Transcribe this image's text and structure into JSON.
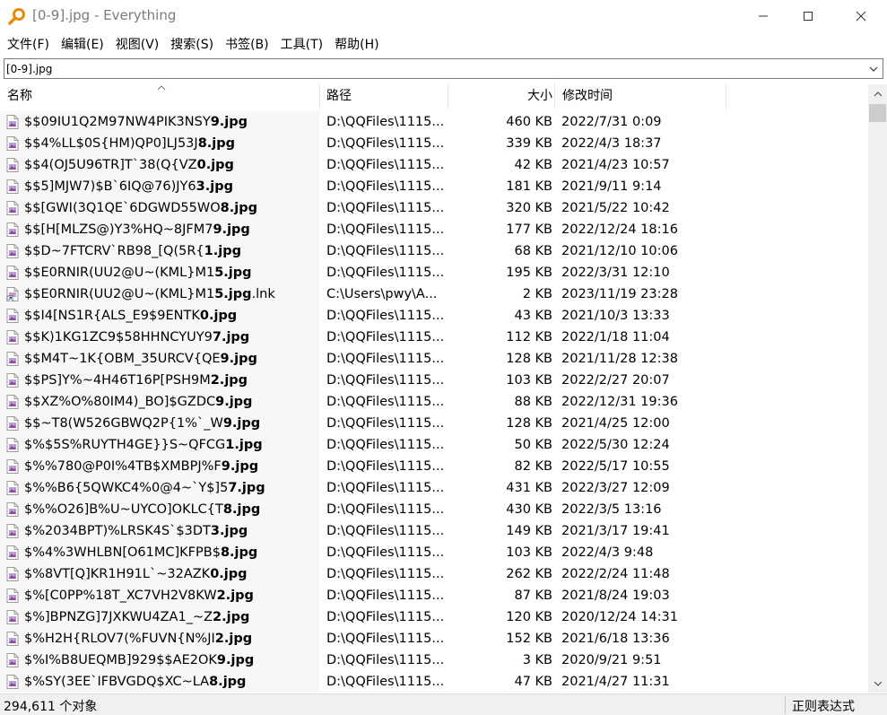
{
  "window": {
    "title": "[0-9].jpg - Everything",
    "app_icon": "magnifier-icon",
    "controls": [
      "minimize-icon",
      "maximize-icon",
      "close-icon"
    ]
  },
  "menu": [
    "文件(F)",
    "编辑(E)",
    "视图(V)",
    "搜索(S)",
    "书签(B)",
    "工具(T)",
    "帮助(H)"
  ],
  "search": {
    "value": "[0-9].jpg"
  },
  "columns": {
    "name": "名称",
    "path": "路径",
    "size": "大小",
    "date": "修改时间",
    "sorted_by": "name",
    "sort_dir": "ascending"
  },
  "rows": [
    {
      "pre": "$$09IU1Q2M97NW4PIK3NSY",
      "match": "9.jpg",
      "post": "",
      "path": "D:\\QQFiles\\1115...",
      "size": "460 KB",
      "date": "2022/7/31 0:09",
      "icon": "image-file-icon"
    },
    {
      "pre": "$$4%LL$0S{HM)QP0]LJ53J",
      "match": "8.jpg",
      "post": "",
      "path": "D:\\QQFiles\\1115...",
      "size": "339 KB",
      "date": "2022/4/3 18:37",
      "icon": "image-file-icon"
    },
    {
      "pre": "$$4(OJ5U96TR]T`38(Q{VZ",
      "match": "0.jpg",
      "post": "",
      "path": "D:\\QQFiles\\1115...",
      "size": "42 KB",
      "date": "2021/4/23 10:57",
      "icon": "image-file-icon"
    },
    {
      "pre": "$$5]MJW7)$B`6IQ@76)JY6",
      "match": "3.jpg",
      "post": "",
      "path": "D:\\QQFiles\\1115...",
      "size": "181 KB",
      "date": "2021/9/11 9:14",
      "icon": "image-file-icon"
    },
    {
      "pre": "$$[GWI(3Q1QE`6DGWD55WO",
      "match": "8.jpg",
      "post": "",
      "path": "D:\\QQFiles\\1115...",
      "size": "320 KB",
      "date": "2021/5/22 10:42",
      "icon": "image-file-icon"
    },
    {
      "pre": "$$[H[MLZS@)Y3%HQ~8JFM7",
      "match": "9.jpg",
      "post": "",
      "path": "D:\\QQFiles\\1115...",
      "size": "177 KB",
      "date": "2022/12/24 18:16",
      "icon": "image-file-icon"
    },
    {
      "pre": "$$D~7FTCRV`RB98_[Q(5R{",
      "match": "1.jpg",
      "post": "",
      "path": "D:\\QQFiles\\1115...",
      "size": "68 KB",
      "date": "2021/12/10 10:06",
      "icon": "image-file-icon"
    },
    {
      "pre": "$$E0RNIR(UU2@U~(KML}M1",
      "match": "5.jpg",
      "post": "",
      "path": "D:\\QQFiles\\1115...",
      "size": "195 KB",
      "date": "2022/3/31 12:10",
      "icon": "image-file-icon"
    },
    {
      "pre": "$$E0RNIR(UU2@U~(KML}M1",
      "match": "5.jpg",
      "post": ".lnk",
      "path": "C:\\Users\\pwy\\A...",
      "size": "2 KB",
      "date": "2023/11/19 23:28",
      "icon": "shortcut-file-icon"
    },
    {
      "pre": "$$I4[NS1R{ALS_E9$9ENTK",
      "match": "0.jpg",
      "post": "",
      "path": "D:\\QQFiles\\1115...",
      "size": "43 KB",
      "date": "2021/10/3 13:33",
      "icon": "image-file-icon"
    },
    {
      "pre": "$$K)1KG1ZC9$58HHNCYUY9",
      "match": "7.jpg",
      "post": "",
      "path": "D:\\QQFiles\\1115...",
      "size": "112 KB",
      "date": "2022/1/18 11:04",
      "icon": "image-file-icon"
    },
    {
      "pre": "$$M4T~1K{OBM_35URCV{QE",
      "match": "9.jpg",
      "post": "",
      "path": "D:\\QQFiles\\1115...",
      "size": "128 KB",
      "date": "2021/11/28 12:38",
      "icon": "image-file-icon"
    },
    {
      "pre": "$$PS]Y%~4H46T16P[PSH9M",
      "match": "2.jpg",
      "post": "",
      "path": "D:\\QQFiles\\1115...",
      "size": "103 KB",
      "date": "2022/2/27 20:07",
      "icon": "image-file-icon"
    },
    {
      "pre": "$$XZ%O%80IM4)_BO]$GZDC",
      "match": "9.jpg",
      "post": "",
      "path": "D:\\QQFiles\\1115...",
      "size": "88 KB",
      "date": "2022/12/31 19:36",
      "icon": "image-file-icon"
    },
    {
      "pre": "$$~T8(W526GBWQ2P{1%`_W",
      "match": "9.jpg",
      "post": "",
      "path": "D:\\QQFiles\\1115...",
      "size": "128 KB",
      "date": "2021/4/25 12:00",
      "icon": "image-file-icon"
    },
    {
      "pre": "$%$5S%RUYTH4GE}}S~QFCG",
      "match": "1.jpg",
      "post": "",
      "path": "D:\\QQFiles\\1115...",
      "size": "50 KB",
      "date": "2022/5/30 12:24",
      "icon": "image-file-icon"
    },
    {
      "pre": "$%%780@P0I%4TB$XMBPJ%F",
      "match": "9.jpg",
      "post": "",
      "path": "D:\\QQFiles\\1115...",
      "size": "82 KB",
      "date": "2022/5/17 10:55",
      "icon": "image-file-icon"
    },
    {
      "pre": "$%%B6{5QWKC4%0@4~`Y$]5",
      "match": "7.jpg",
      "post": "",
      "path": "D:\\QQFiles\\1115...",
      "size": "431 KB",
      "date": "2022/3/27 12:09",
      "icon": "image-file-icon"
    },
    {
      "pre": "$%%O26]B%U~UYCO]OKLC{T",
      "match": "8.jpg",
      "post": "",
      "path": "D:\\QQFiles\\1115...",
      "size": "430 KB",
      "date": "2022/3/5 13:16",
      "icon": "image-file-icon"
    },
    {
      "pre": "$%2034BPT)%LRSK4S`$3DT",
      "match": "3.jpg",
      "post": "",
      "path": "D:\\QQFiles\\1115...",
      "size": "149 KB",
      "date": "2021/3/17 19:41",
      "icon": "image-file-icon"
    },
    {
      "pre": "$%4%3WHLBN[O61MC]KFPB$",
      "match": "8.jpg",
      "post": "",
      "path": "D:\\QQFiles\\1115...",
      "size": "103 KB",
      "date": "2022/4/3 9:48",
      "icon": "image-file-icon"
    },
    {
      "pre": "$%8VT[Q]KR1H91L`~32AZK",
      "match": "0.jpg",
      "post": "",
      "path": "D:\\QQFiles\\1115...",
      "size": "262 KB",
      "date": "2022/2/24 11:48",
      "icon": "image-file-icon"
    },
    {
      "pre": "$%[C0PP%18T_XC7VH2V8KW",
      "match": "2.jpg",
      "post": "",
      "path": "D:\\QQFiles\\1115...",
      "size": "87 KB",
      "date": "2021/8/24 19:03",
      "icon": "image-file-icon"
    },
    {
      "pre": "$%]BPNZG]7JXKWU4ZA1_~Z",
      "match": "2.jpg",
      "post": "",
      "path": "D:\\QQFiles\\1115...",
      "size": "120 KB",
      "date": "2020/12/24 14:31",
      "icon": "image-file-icon"
    },
    {
      "pre": "$%H2H{RLOV7(%FUVN{N%JI",
      "match": "2.jpg",
      "post": "",
      "path": "D:\\QQFiles\\1115...",
      "size": "152 KB",
      "date": "2021/6/18 13:36",
      "icon": "image-file-icon"
    },
    {
      "pre": "$%I%B8UEQMB]929$$AE2OK",
      "match": "9.jpg",
      "post": "",
      "path": "D:\\QQFiles\\1115...",
      "size": "3 KB",
      "date": "2020/9/21 9:51",
      "icon": "image-file-icon"
    },
    {
      "pre": "$%SY(3EE`IFBVGDQ$XC~LA",
      "match": "8.jpg",
      "post": "",
      "path": "D:\\QQFiles\\1115...",
      "size": "47 KB",
      "date": "2021/4/27 11:31",
      "icon": "image-file-icon"
    }
  ],
  "status": {
    "count": "294,611 个对象",
    "mode": "正则表达式"
  },
  "colors": {
    "title_text": "#7a7a7a",
    "name_column_bg": "#f7f7f7",
    "statusbar_bg": "#f0f0f0",
    "file_icon_purple": "#9b59b6",
    "app_icon_orange": "#e8890c"
  }
}
